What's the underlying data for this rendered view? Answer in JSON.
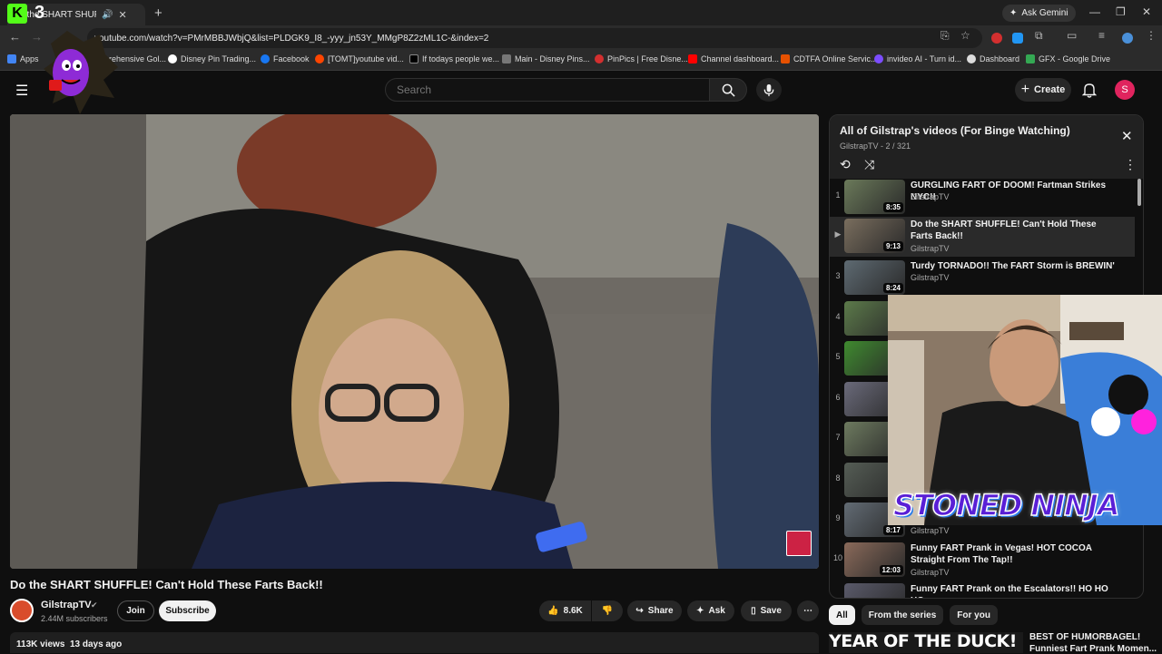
{
  "browser": {
    "tab_title": "Do the SHART SHUFFLE! Ca",
    "new_tab": "+",
    "ask_gemini": "Ask Gemini",
    "url": "youtube.com/watch?v=PMrMBBJWbjQ&list=PLDGK9_I8_-yyy_jn53Y_MMgP8Z2zML1C-&index=2",
    "bookmarks": [
      {
        "label": "Apps",
        "color": "#4285f4"
      },
      {
        "label": "Comprehensive Gol...",
        "color": "#888888"
      },
      {
        "label": "Disney Pin Trading...",
        "color": "#ffffff"
      },
      {
        "label": "Facebook",
        "color": "#1877f2"
      },
      {
        "label": "[TOMT]youtube vid...",
        "color": "#ff4500"
      },
      {
        "label": "If todays people we...",
        "color": "#000000"
      },
      {
        "label": "Main - Disney Pins...",
        "color": "#777777"
      },
      {
        "label": "PinPics | Free Disne...",
        "color": "#d32f2f"
      },
      {
        "label": "Channel dashboard...",
        "color": "#ff0000"
      },
      {
        "label": "CDTFA Online Servic...",
        "color": "#e65100"
      },
      {
        "label": "invideo AI - Turn id...",
        "color": "#7c4dff"
      },
      {
        "label": "Dashboard",
        "color": "#dddddd"
      },
      {
        "label": "GFX - Google Drive",
        "color": "#34a853"
      }
    ]
  },
  "header": {
    "search_placeholder": "Search",
    "create_label": "Create",
    "avatar_letter": "S"
  },
  "video": {
    "title": "Do the SHART SHUFFLE! Can't Hold These Farts Back!!",
    "channel": "GilstrapTV",
    "subscribers": "2.44M subscribers",
    "join": "Join",
    "subscribe": "Subscribe",
    "likes": "8.6K",
    "share": "Share",
    "ask": "Ask",
    "save": "Save",
    "views": "113K views",
    "age": "13 days ago"
  },
  "playlist": {
    "title": "All of Gilstrap's videos (For Binge Watching)",
    "owner": "GilstrapTV",
    "position": "2 / 321",
    "items": [
      {
        "index": "1",
        "title": "GURGLING FART OF DOOM! Fartman Strikes NYC!!",
        "channel": "GilstrapTV",
        "duration": "8:35",
        "color": "#6b7a5a"
      },
      {
        "index": "▶",
        "title": "Do the SHART SHUFFLE! Can't Hold These Farts Back!!",
        "channel": "GilstrapTV",
        "duration": "9:13",
        "color": "#7a6e5e"
      },
      {
        "index": "3",
        "title": "Turdy TORNADO!! The FART Storm is BREWIN'",
        "channel": "GilstrapTV",
        "duration": "8:24",
        "color": "#5e6a72"
      },
      {
        "index": "4",
        "title": "",
        "channel": "",
        "duration": "",
        "color": "#5c7a4a"
      },
      {
        "index": "5",
        "title": "",
        "channel": "",
        "duration": "",
        "color": "#3f8a2f"
      },
      {
        "index": "6",
        "title": "",
        "channel": "",
        "duration": "",
        "color": "#6a6a7a"
      },
      {
        "index": "7",
        "title": "",
        "channel": "",
        "duration": "",
        "color": "#6d7a5f"
      },
      {
        "index": "8",
        "title": "",
        "channel": "",
        "duration": "",
        "color": "#555d55"
      },
      {
        "index": "9",
        "title": "",
        "channel": "GilstrapTV",
        "duration": "8:17",
        "color": "#626b74"
      },
      {
        "index": "10",
        "title": "Funny FART Prank in Vegas! HOT COCOA Straight From The Tap!!",
        "channel": "GilstrapTV",
        "duration": "12:03",
        "color": "#8a6a5a"
      },
      {
        "index": "",
        "title": "Funny FART Prank on the Escalators!! HO HO HO-",
        "channel": "",
        "duration": "",
        "color": "#5a5a6a"
      }
    ]
  },
  "overlay": {
    "logo_k": "K",
    "logo_3": "3",
    "webcam_banner": "STONED NINJA"
  },
  "chips": [
    "All",
    "From the series",
    "For you"
  ],
  "recommendation": {
    "thumb_text": "YEAR OF THE DUCK!",
    "title_line1": "BEST OF HUMORBAGEL!",
    "title_line2": "Funniest Fart Prank Momen..."
  }
}
